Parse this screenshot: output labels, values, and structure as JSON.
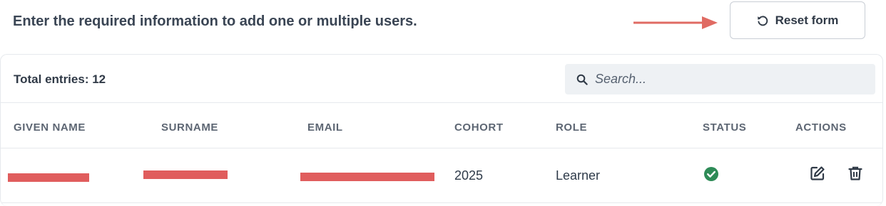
{
  "intro_text": "Enter the required information to add one or multiple users.",
  "reset_button": {
    "label": "Reset form",
    "icon": "reset-icon"
  },
  "annotation_arrow": {
    "color": "#e06b63"
  },
  "table": {
    "total_label": "Total entries: 12",
    "search": {
      "placeholder": "Search...",
      "value": "",
      "icon": "search-icon"
    },
    "columns": [
      "GIVEN NAME",
      "SURNAME",
      "EMAIL",
      "COHORT",
      "ROLE",
      "STATUS",
      "ACTIONS"
    ],
    "rows": [
      {
        "given_name": "",
        "surname": "",
        "email": "",
        "cohort": "2025",
        "role": "Learner",
        "status": "check-circle-icon",
        "actions": [
          "edit-icon",
          "delete-icon"
        ]
      }
    ]
  },
  "colors": {
    "status_ok": "#2e8b57",
    "redaction": "#e05d5d"
  }
}
